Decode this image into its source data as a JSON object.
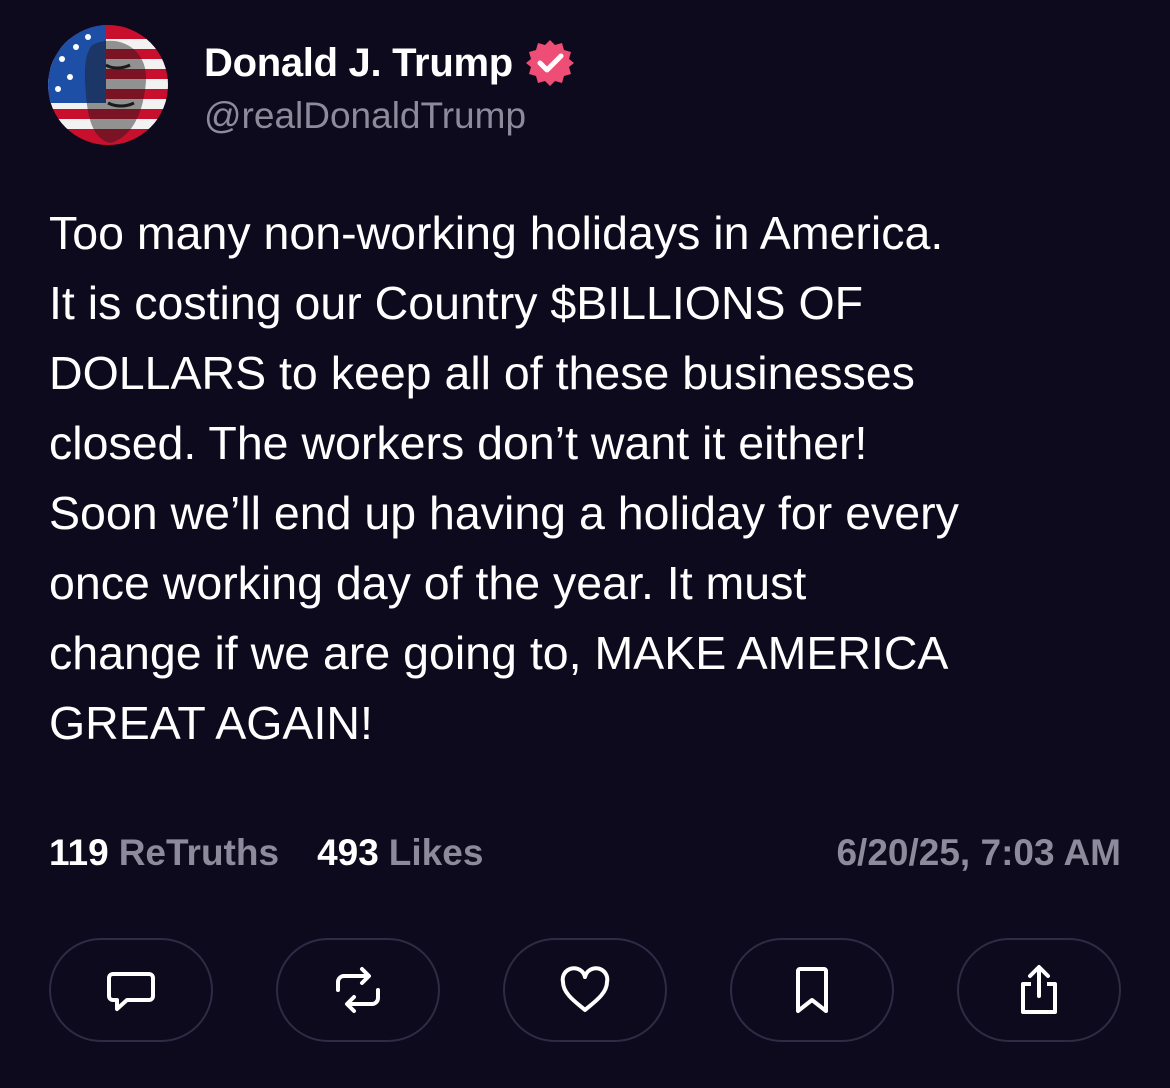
{
  "author": {
    "display_name": "Donald J. Trump",
    "handle": "@realDonaldTrump",
    "verified": true,
    "avatar_icon": "flag-portrait-avatar",
    "verified_icon": "verified-badge-icon"
  },
  "post": {
    "text": "Too many non-working holidays in America.\nIt is costing our Country $BILLIONS OF\nDOLLARS to keep all of these businesses\nclosed. The workers don’t want it either!\nSoon we’ll end up having a holiday for every\nonce working day of the year. It must\nchange if we are going to, MAKE AMERICA\nGREAT AGAIN!"
  },
  "stats": {
    "retruths_count": "119",
    "retruths_label": "ReTruths",
    "likes_count": "493",
    "likes_label": "Likes",
    "timestamp": "6/20/25, 7:03 AM"
  },
  "actions": [
    {
      "icon": "reply-icon"
    },
    {
      "icon": "retruth-icon"
    },
    {
      "icon": "like-heart-icon"
    },
    {
      "icon": "bookmark-icon"
    },
    {
      "icon": "share-icon"
    }
  ],
  "colors": {
    "background": "#0c0a1c",
    "primary_text": "#ffffff",
    "secondary_text": "#8d8a9c",
    "verified_badge": "#ee4e75",
    "button_border": "#2e2b45"
  }
}
